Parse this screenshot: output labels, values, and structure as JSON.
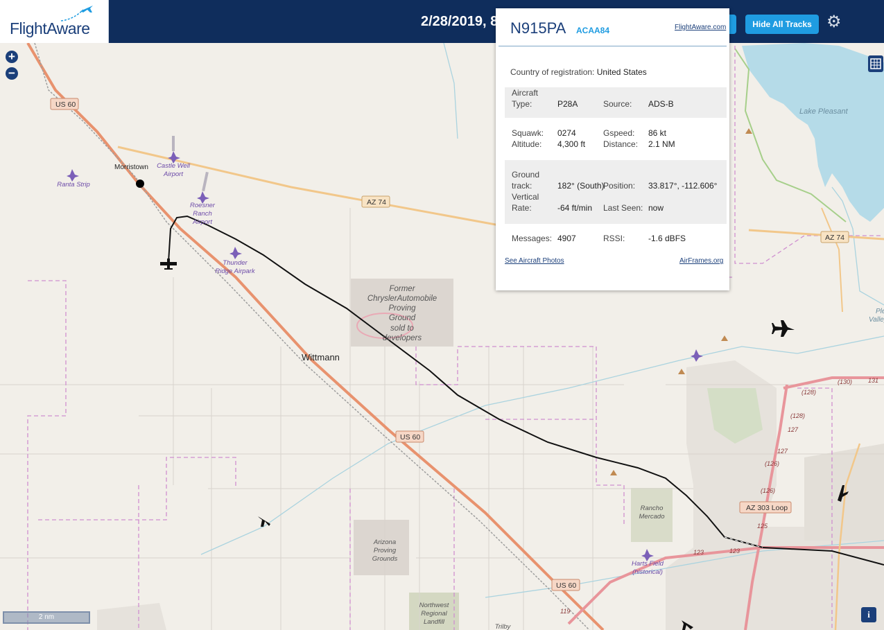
{
  "header": {
    "brand": "FlightAware",
    "time_text": "2/28/2019, 8",
    "hide_tracks_label": "Hide All Tracks"
  },
  "controls": {
    "zoom_in": "+",
    "zoom_out": "−",
    "scale_label": "2 nm",
    "info": "i"
  },
  "popup": {
    "ident": "N915PA",
    "callsign": "ACAA84",
    "flightaware_link": "FlightAware.com",
    "country_label": "Country of registration:",
    "country_value": "United States",
    "aircraft_type_label_1": "Aircraft",
    "aircraft_type_label_2": "Type:",
    "aircraft_type_value": "P28A",
    "source_label": "Source:",
    "source_value": "ADS-B",
    "squawk_label": "Squawk:",
    "squawk_value": "0274",
    "gspeed_label": "Gspeed:",
    "gspeed_value": "86 kt",
    "altitude_label": "Altitude:",
    "altitude_value": "4,300 ft",
    "distance_label": "Distance:",
    "distance_value": "2.1 NM",
    "ground_track_label_1": "Ground",
    "ground_track_label_2": "track:",
    "ground_track_value": "182° (South)",
    "position_label": "Position:",
    "position_value": "33.817°, -112.606°",
    "vertical_rate_label_1": "Vertical",
    "vertical_rate_label_2": "Rate:",
    "vertical_rate_value": "-64 ft/min",
    "last_seen_label": "Last Seen:",
    "last_seen_value": "now",
    "messages_label": "Messages:",
    "messages_value": "4907",
    "rssi_label": "RSSI:",
    "rssi_value": "-1.6 dBFS",
    "photos_link": "See Aircraft Photos",
    "airframes_link": "AirFrames.org"
  },
  "map_labels": {
    "us60_a": "US 60",
    "us60_b": "US 60",
    "us60_c": "US 60",
    "az74_a": "AZ 74",
    "az74_b": "AZ 74",
    "az303": "AZ 303 Loop",
    "morristown": "Morristown",
    "wittmann": "Wittmann",
    "lake_pleasant": "Lake Pleasant",
    "pleasant_valley_1": "Ple",
    "pleasant_valley_2": "Valley",
    "castle_well_1": "Castle Well",
    "castle_well_2": "Airport",
    "ranta_strip": "Ranta Strip",
    "roesner_1": "Roesner",
    "roesner_2": "Ranch",
    "roesner_3": "Airport",
    "thunder_1": "Thunder",
    "thunder_2": "Ridge Airpark",
    "chrysler_1": "Former",
    "chrysler_2": "ChryslerAutomobile",
    "chrysler_3": "Proving",
    "chrysler_4": "Ground",
    "chrysler_5": "sold to",
    "chrysler_6": "developers",
    "arizona_pg_1": "Arizona",
    "arizona_pg_2": "Proving",
    "arizona_pg_3": "Grounds",
    "rancho_1": "Rancho",
    "rancho_2": "Mercado",
    "harts_1": "Harts Field",
    "harts_2": "(historical)",
    "landfill_1": "Northwest",
    "landfill_2": "Regional",
    "landfill_3": "Landfill",
    "trilby": "Trilby",
    "r123_a": "123",
    "r123_b": "123",
    "r125": "125",
    "r127_a": "127",
    "r127_b": "127",
    "r126_a": "(126)",
    "r126_b": "(126)",
    "r128_a": "(128)",
    "r128_b": "(128)",
    "r130": "(130)",
    "r131": "131",
    "r119": "119"
  },
  "colors": {
    "header_bg": "#0f2d5c",
    "button": "#1f9ce1",
    "map_bg": "#f2efe9",
    "highway": "#e8926e",
    "state_route": "#f2c78a",
    "boundary": "#c879c8",
    "water": "#aad3df",
    "track": "#111111",
    "airport": "#7b5fb8"
  }
}
